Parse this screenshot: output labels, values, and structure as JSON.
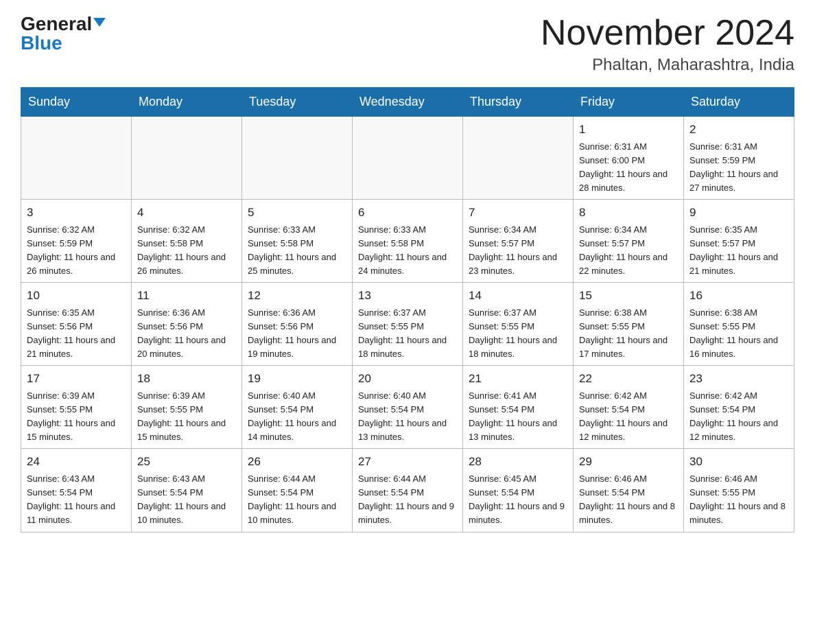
{
  "header": {
    "logo_general": "General",
    "logo_blue": "Blue",
    "month_title": "November 2024",
    "location": "Phaltan, Maharashtra, India"
  },
  "days_of_week": [
    "Sunday",
    "Monday",
    "Tuesday",
    "Wednesday",
    "Thursday",
    "Friday",
    "Saturday"
  ],
  "weeks": [
    [
      {
        "date": "",
        "info": ""
      },
      {
        "date": "",
        "info": ""
      },
      {
        "date": "",
        "info": ""
      },
      {
        "date": "",
        "info": ""
      },
      {
        "date": "",
        "info": ""
      },
      {
        "date": "1",
        "info": "Sunrise: 6:31 AM\nSunset: 6:00 PM\nDaylight: 11 hours and 28 minutes."
      },
      {
        "date": "2",
        "info": "Sunrise: 6:31 AM\nSunset: 5:59 PM\nDaylight: 11 hours and 27 minutes."
      }
    ],
    [
      {
        "date": "3",
        "info": "Sunrise: 6:32 AM\nSunset: 5:59 PM\nDaylight: 11 hours and 26 minutes."
      },
      {
        "date": "4",
        "info": "Sunrise: 6:32 AM\nSunset: 5:58 PM\nDaylight: 11 hours and 26 minutes."
      },
      {
        "date": "5",
        "info": "Sunrise: 6:33 AM\nSunset: 5:58 PM\nDaylight: 11 hours and 25 minutes."
      },
      {
        "date": "6",
        "info": "Sunrise: 6:33 AM\nSunset: 5:58 PM\nDaylight: 11 hours and 24 minutes."
      },
      {
        "date": "7",
        "info": "Sunrise: 6:34 AM\nSunset: 5:57 PM\nDaylight: 11 hours and 23 minutes."
      },
      {
        "date": "8",
        "info": "Sunrise: 6:34 AM\nSunset: 5:57 PM\nDaylight: 11 hours and 22 minutes."
      },
      {
        "date": "9",
        "info": "Sunrise: 6:35 AM\nSunset: 5:57 PM\nDaylight: 11 hours and 21 minutes."
      }
    ],
    [
      {
        "date": "10",
        "info": "Sunrise: 6:35 AM\nSunset: 5:56 PM\nDaylight: 11 hours and 21 minutes."
      },
      {
        "date": "11",
        "info": "Sunrise: 6:36 AM\nSunset: 5:56 PM\nDaylight: 11 hours and 20 minutes."
      },
      {
        "date": "12",
        "info": "Sunrise: 6:36 AM\nSunset: 5:56 PM\nDaylight: 11 hours and 19 minutes."
      },
      {
        "date": "13",
        "info": "Sunrise: 6:37 AM\nSunset: 5:55 PM\nDaylight: 11 hours and 18 minutes."
      },
      {
        "date": "14",
        "info": "Sunrise: 6:37 AM\nSunset: 5:55 PM\nDaylight: 11 hours and 18 minutes."
      },
      {
        "date": "15",
        "info": "Sunrise: 6:38 AM\nSunset: 5:55 PM\nDaylight: 11 hours and 17 minutes."
      },
      {
        "date": "16",
        "info": "Sunrise: 6:38 AM\nSunset: 5:55 PM\nDaylight: 11 hours and 16 minutes."
      }
    ],
    [
      {
        "date": "17",
        "info": "Sunrise: 6:39 AM\nSunset: 5:55 PM\nDaylight: 11 hours and 15 minutes."
      },
      {
        "date": "18",
        "info": "Sunrise: 6:39 AM\nSunset: 5:55 PM\nDaylight: 11 hours and 15 minutes."
      },
      {
        "date": "19",
        "info": "Sunrise: 6:40 AM\nSunset: 5:54 PM\nDaylight: 11 hours and 14 minutes."
      },
      {
        "date": "20",
        "info": "Sunrise: 6:40 AM\nSunset: 5:54 PM\nDaylight: 11 hours and 13 minutes."
      },
      {
        "date": "21",
        "info": "Sunrise: 6:41 AM\nSunset: 5:54 PM\nDaylight: 11 hours and 13 minutes."
      },
      {
        "date": "22",
        "info": "Sunrise: 6:42 AM\nSunset: 5:54 PM\nDaylight: 11 hours and 12 minutes."
      },
      {
        "date": "23",
        "info": "Sunrise: 6:42 AM\nSunset: 5:54 PM\nDaylight: 11 hours and 12 minutes."
      }
    ],
    [
      {
        "date": "24",
        "info": "Sunrise: 6:43 AM\nSunset: 5:54 PM\nDaylight: 11 hours and 11 minutes."
      },
      {
        "date": "25",
        "info": "Sunrise: 6:43 AM\nSunset: 5:54 PM\nDaylight: 11 hours and 10 minutes."
      },
      {
        "date": "26",
        "info": "Sunrise: 6:44 AM\nSunset: 5:54 PM\nDaylight: 11 hours and 10 minutes."
      },
      {
        "date": "27",
        "info": "Sunrise: 6:44 AM\nSunset: 5:54 PM\nDaylight: 11 hours and 9 minutes."
      },
      {
        "date": "28",
        "info": "Sunrise: 6:45 AM\nSunset: 5:54 PM\nDaylight: 11 hours and 9 minutes."
      },
      {
        "date": "29",
        "info": "Sunrise: 6:46 AM\nSunset: 5:54 PM\nDaylight: 11 hours and 8 minutes."
      },
      {
        "date": "30",
        "info": "Sunrise: 6:46 AM\nSunset: 5:55 PM\nDaylight: 11 hours and 8 minutes."
      }
    ]
  ]
}
